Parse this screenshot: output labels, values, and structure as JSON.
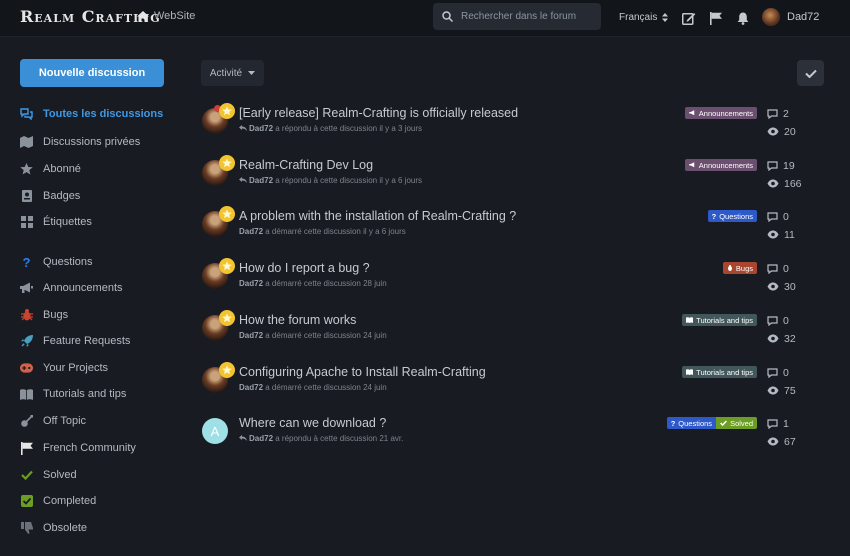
{
  "header": {
    "logo": "Realm Crafting",
    "website_label": "WebSite",
    "search_placeholder": "Rechercher dans le forum",
    "language": "Français",
    "username": "Dad72"
  },
  "sidebar": {
    "new_discussion": "Nouvelle discussion",
    "items": [
      {
        "label": "Toutes les discussions",
        "icon": "comments-icon",
        "color": "#3d99e6"
      },
      {
        "label": "Discussions privées",
        "icon": "map-icon",
        "color": "#8a929c"
      },
      {
        "label": "Abonné",
        "icon": "star-icon",
        "color": "#8a929c"
      },
      {
        "label": "Badges",
        "icon": "badge-icon",
        "color": "#8a929c"
      },
      {
        "label": "Étiquettes",
        "icon": "grid-icon",
        "color": "#8a929c"
      },
      {
        "label": "Questions",
        "icon": "question-icon",
        "color": "#2e59c8"
      },
      {
        "label": "Announcements",
        "icon": "megaphone-icon",
        "color": "#8a929c"
      },
      {
        "label": "Bugs",
        "icon": "bug-icon",
        "color": "#c9452f"
      },
      {
        "label": "Feature Requests",
        "icon": "rocket-icon",
        "color": "#4a9fc0"
      },
      {
        "label": "Your Projects",
        "icon": "gamepad-icon",
        "color": "#d0624a"
      },
      {
        "label": "Tutorials and tips",
        "icon": "book-icon",
        "color": "#8a929c"
      },
      {
        "label": "Off Topic",
        "icon": "guitar-icon",
        "color": "#8a929c"
      },
      {
        "label": "French Community",
        "icon": "flag-icon",
        "color": "#e6e6e6"
      },
      {
        "label": "Solved",
        "icon": "check-icon",
        "color": "#6c9d24"
      },
      {
        "label": "Completed",
        "icon": "check-square-icon",
        "color": "#6c9d24"
      },
      {
        "label": "Obsolete",
        "icon": "thumbs-down-icon",
        "color": "#6c727a"
      }
    ]
  },
  "toolbar": {
    "sort_label": "Activité"
  },
  "discussions": [
    {
      "title": "[Early release] Realm-Crafting is officially released",
      "author": "Dad72",
      "action": "a répondu à cette discussion il y a 3 jours",
      "reply_arrow": true,
      "pinned": true,
      "tags": [
        {
          "label": "Announcements",
          "type": "ann"
        }
      ],
      "replies": "2",
      "views": "20"
    },
    {
      "title": "Realm-Crafting Dev Log",
      "author": "Dad72",
      "action": "a répondu à cette discussion il y a 6 jours",
      "reply_arrow": true,
      "pinned": false,
      "tags": [
        {
          "label": "Announcements",
          "type": "ann"
        }
      ],
      "replies": "19",
      "views": "166"
    },
    {
      "title": "A problem with the installation of Realm-Crafting ?",
      "author": "Dad72",
      "action": "a démarré cette discussion il y a 6 jours",
      "reply_arrow": false,
      "pinned": false,
      "tags": [
        {
          "label": "Questions",
          "type": "q"
        }
      ],
      "replies": "0",
      "views": "11"
    },
    {
      "title": "How do I report a bug ?",
      "author": "Dad72",
      "action": "a démarré cette discussion 28 juin",
      "reply_arrow": false,
      "pinned": false,
      "tags": [
        {
          "label": "Bugs",
          "type": "bug"
        }
      ],
      "replies": "0",
      "views": "30"
    },
    {
      "title": "How the forum works",
      "author": "Dad72",
      "action": "a démarré cette discussion 24 juin",
      "reply_arrow": false,
      "pinned": false,
      "tags": [
        {
          "label": "Tutorials and tips",
          "type": "tut"
        }
      ],
      "replies": "0",
      "views": "32"
    },
    {
      "title": "Configuring Apache to Install Realm-Crafting",
      "author": "Dad72",
      "action": "a démarré cette discussion 24 juin",
      "reply_arrow": false,
      "pinned": false,
      "tags": [
        {
          "label": "Tutorials and tips",
          "type": "tut"
        }
      ],
      "replies": "0",
      "views": "75"
    },
    {
      "title": "Where can we download ?",
      "author": "Dad72",
      "action": "a répondu à cette discussion 21 avr.",
      "reply_arrow": true,
      "pinned": false,
      "avatar_letter": "A",
      "tags": [
        {
          "label": "Questions",
          "type": "q"
        },
        {
          "label": "Solved",
          "type": "solved"
        }
      ],
      "replies": "1",
      "views": "67"
    }
  ]
}
